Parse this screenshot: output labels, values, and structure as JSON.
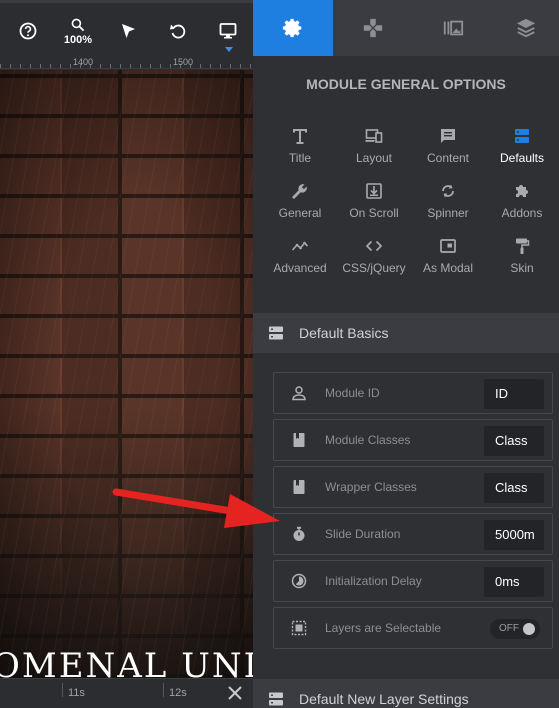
{
  "toolbar": {
    "zoom_label": "100%",
    "icons": [
      "help-icon",
      "zoom-icon",
      "select-arrow-icon",
      "undo-icon",
      "desktop-icon"
    ]
  },
  "ruler": {
    "labels": [
      "1400",
      "1500"
    ]
  },
  "canvas": {
    "hero_text": "OMENAL UNDER"
  },
  "timeline": {
    "labels": [
      "11s",
      "12s"
    ]
  },
  "panel": {
    "tabs": [
      "settings-icon",
      "gamepad-icon",
      "media-icon",
      "layers-icon"
    ],
    "title": "MODULE GENERAL OPTIONS",
    "options": [
      {
        "label": "Title",
        "icon": "title-icon"
      },
      {
        "label": "Layout",
        "icon": "layout-icon"
      },
      {
        "label": "Content",
        "icon": "content-icon"
      },
      {
        "label": "Defaults",
        "icon": "defaults-icon",
        "active": true
      },
      {
        "label": "General",
        "icon": "wrench-icon"
      },
      {
        "label": "On Scroll",
        "icon": "scroll-icon"
      },
      {
        "label": "Spinner",
        "icon": "spinner-icon"
      },
      {
        "label": "Addons",
        "icon": "puzzle-icon"
      },
      {
        "label": "Advanced",
        "icon": "advanced-icon"
      },
      {
        "label": "CSS/jQuery",
        "icon": "code-icon"
      },
      {
        "label": "As Modal",
        "icon": "modal-icon"
      },
      {
        "label": "Skin",
        "icon": "paint-roller-icon"
      }
    ],
    "section_basics": "Default Basics",
    "section_layers": "Default New Layer Settings",
    "rows": {
      "module_id": {
        "label": "Module ID",
        "value": "ID"
      },
      "module_classes": {
        "label": "Module Classes",
        "value": "Class"
      },
      "wrapper_classes": {
        "label": "Wrapper Classes",
        "value": "Class"
      },
      "slide_duration": {
        "label": "Slide Duration",
        "value": "5000m"
      },
      "init_delay": {
        "label": "Initialization Delay",
        "value": "0ms"
      },
      "layers_selectable": {
        "label": "Layers are Selectable",
        "value": "OFF"
      }
    }
  },
  "colors": {
    "accent": "#1e7fe0",
    "annotation_arrow": "#e52421"
  }
}
